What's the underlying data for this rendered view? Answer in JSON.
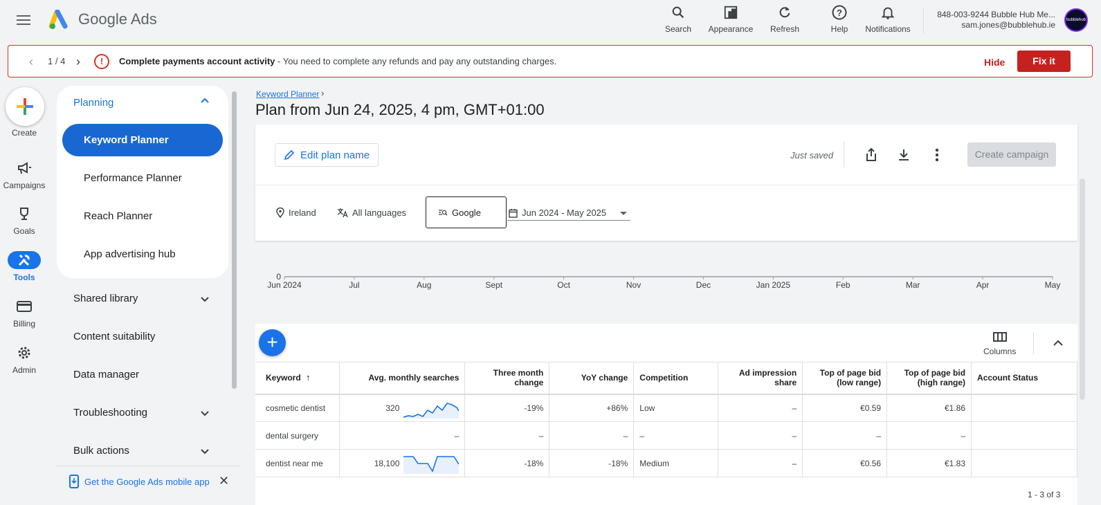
{
  "header": {
    "brand": "Google Ads",
    "actions": [
      {
        "label": "Search",
        "icon": "search-icon"
      },
      {
        "label": "Appearance",
        "icon": "appearance-icon"
      },
      {
        "label": "Refresh",
        "icon": "refresh-icon"
      },
      {
        "label": "Help",
        "icon": "help-icon"
      },
      {
        "label": "Notifications",
        "icon": "bell-icon"
      }
    ],
    "account_line1": "848-003-9244 Bubble Hub Me...",
    "account_line2": "sam.jones@bubblehub.ie",
    "avatar_text": "bubblehub"
  },
  "alert": {
    "pager": "1 / 4",
    "title": "Complete payments account activity",
    "message": " - You need to complete any refunds and pay any outstanding charges.",
    "hide_label": "Hide",
    "fix_label": "Fix it"
  },
  "rail": {
    "create_label": "Create",
    "items": [
      {
        "label": "Campaigns",
        "icon": "megaphone-icon"
      },
      {
        "label": "Goals",
        "icon": "trophy-icon"
      },
      {
        "label": "Tools",
        "icon": "tools-icon"
      },
      {
        "label": "Billing",
        "icon": "card-icon"
      },
      {
        "label": "Admin",
        "icon": "gear-icon"
      }
    ]
  },
  "nav": {
    "section": "Planning",
    "links": [
      "Keyword Planner",
      "Performance Planner",
      "Reach Planner",
      "App advertising hub"
    ],
    "groups": [
      "Shared library",
      "Content suitability",
      "Data manager",
      "Troubleshooting",
      "Bulk actions"
    ],
    "mobile_app": "Get the Google Ads mobile app"
  },
  "main": {
    "breadcrumb": "Keyword Planner",
    "title": "Plan from Jun 24, 2025, 4 pm, GMT+01:00",
    "edit_plan": "Edit plan name",
    "saved": "Just saved",
    "create_campaign": "Create campaign",
    "filters": {
      "location": "Ireland",
      "language": "All languages",
      "network": "Google",
      "date_range": "Jun 2024 - May 2025"
    }
  },
  "chart_data": {
    "type": "line",
    "x": [
      "Jun 2024",
      "Jul",
      "Aug",
      "Sept",
      "Oct",
      "Nov",
      "Dec",
      "Jan 2025",
      "Feb",
      "Mar",
      "Apr",
      "May"
    ],
    "yticks": [
      "0"
    ]
  },
  "table": {
    "columns_label": "Columns",
    "headers": [
      "Keyword",
      "Avg. monthly searches",
      "Three month change",
      "YoY change",
      "Competition",
      "Ad impression share",
      "Top of page bid (low range)",
      "Top of page bid (high range)",
      "Account Status"
    ],
    "rows": [
      {
        "keyword": "cosmetic dentist",
        "avg": "320",
        "three": "-19%",
        "yoy": "+86%",
        "comp": "Low",
        "share": "–",
        "low": "€0.59",
        "high": "€1.86",
        "status": ""
      },
      {
        "keyword": "dental surgery",
        "avg": "–",
        "three": "–",
        "yoy": "–",
        "comp": "–",
        "share": "–",
        "low": "–",
        "high": "–",
        "status": ""
      },
      {
        "keyword": "dentist near me",
        "avg": "18,100",
        "three": "-18%",
        "yoy": "-18%",
        "comp": "Medium",
        "share": "–",
        "low": "€0.56",
        "high": "€1.83",
        "status": ""
      }
    ],
    "pagination": "1 - 3 of 3"
  }
}
